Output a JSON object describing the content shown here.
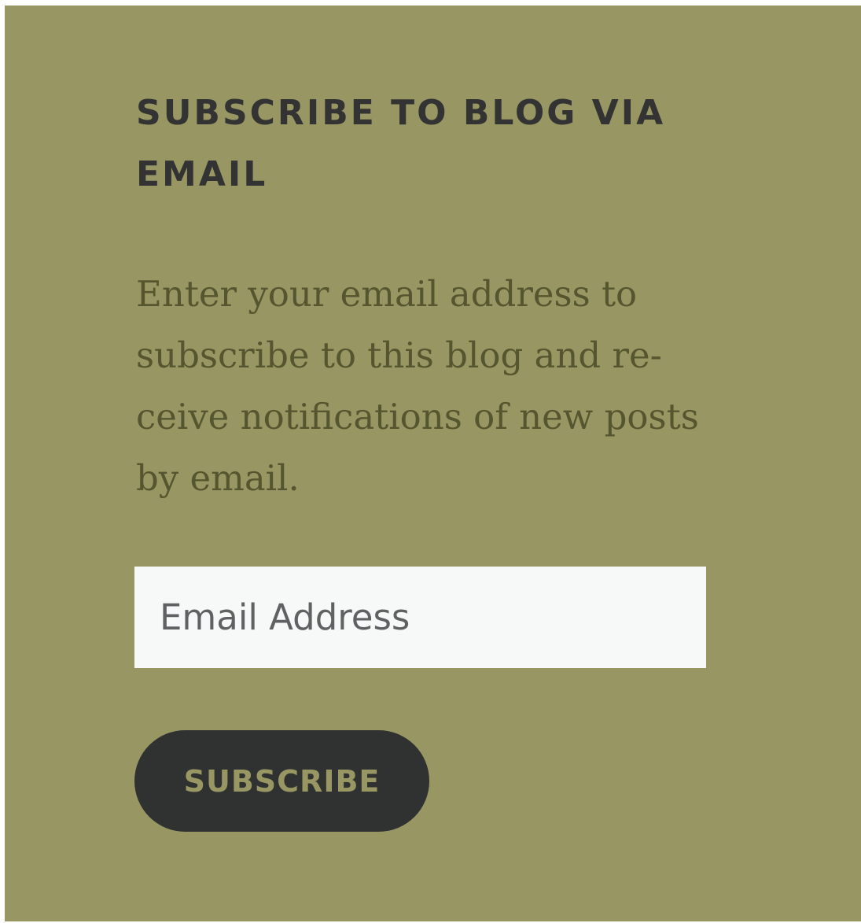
{
  "widget": {
    "title": "SUBSCRIBE TO BLOG VIA EMAIL",
    "description": "Enter your email address to subscribe to this blog and re­ceive notifications of new posts by email.",
    "email_placeholder": "Email Address",
    "email_value": "",
    "subscribe_label": "SUBSCRIBE"
  },
  "colors": {
    "background": "#989763",
    "title_text": "#333333",
    "description_text": "#55562f",
    "input_background": "#f7f9f8",
    "button_background": "#303131",
    "button_text": "#989763"
  }
}
